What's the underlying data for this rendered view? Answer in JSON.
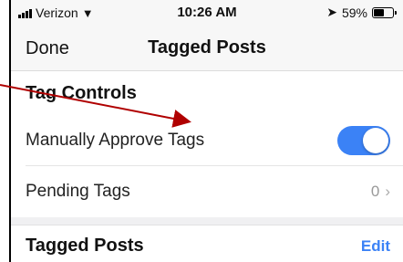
{
  "status_bar": {
    "carrier": "Verizon",
    "time": "10:26 AM",
    "battery_percent": "59%",
    "battery_level": 0.59,
    "icons": [
      "signal-icon",
      "wifi-icon",
      "location-icon",
      "battery-icon"
    ]
  },
  "nav": {
    "done_label": "Done",
    "title": "Tagged Posts"
  },
  "tag_controls": {
    "header": "Tag Controls",
    "manual_approve_label": "Manually Approve Tags",
    "manual_approve_on": true,
    "pending_label": "Pending Tags",
    "pending_count": "0"
  },
  "tagged_posts": {
    "header": "Tagged Posts",
    "edit_label": "Edit"
  },
  "colors": {
    "accent": "#3b82f6",
    "annotation_arrow": "#b00000"
  }
}
